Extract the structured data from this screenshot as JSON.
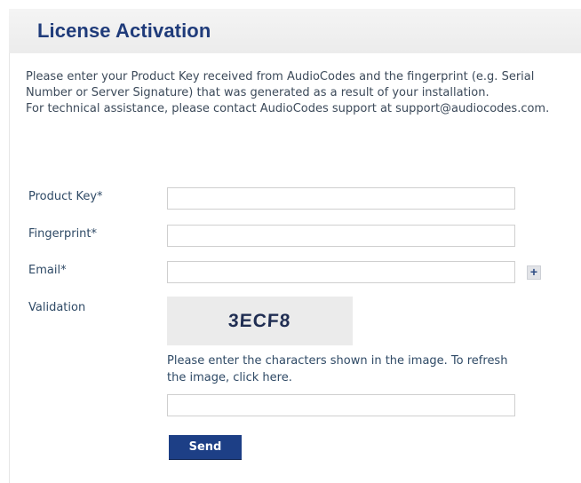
{
  "header": {
    "title": "License Activation"
  },
  "intro": {
    "line1": "Please enter your Product Key received from AudioCodes and the fingerprint (e.g. Serial Number or Server Signature) that was generated as a result of your installation.",
    "line2": "For technical assistance, please contact AudioCodes support at support@audiocodes.com."
  },
  "form": {
    "product_key": {
      "label": "Product Key*",
      "value": "",
      "placeholder": ""
    },
    "fingerprint": {
      "label": "Fingerprint*",
      "value": "",
      "placeholder": ""
    },
    "email": {
      "label": "Email*",
      "value": "",
      "placeholder": "",
      "add_icon": "plus-icon",
      "add_glyph": "+"
    },
    "validation": {
      "label": "Validation",
      "captcha_text": "3ECF8",
      "hint": "Please enter the characters shown in the image. To refresh the image, click here.",
      "value": "",
      "placeholder": ""
    },
    "send_label": "Send"
  },
  "colors": {
    "title": "#1f3b7a",
    "button": "#1d3f86",
    "label": "#2f4a66"
  }
}
